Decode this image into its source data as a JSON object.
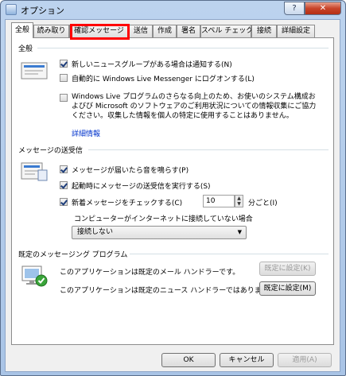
{
  "window": {
    "title": "オプション",
    "help_label": "?",
    "close_label": "✕"
  },
  "tabs": [
    {
      "label": "全般"
    },
    {
      "label": "読み取り"
    },
    {
      "label": "確認メッセージ"
    },
    {
      "label": "送信"
    },
    {
      "label": "作成"
    },
    {
      "label": "署名"
    },
    {
      "label": "スペル チェック"
    },
    {
      "label": "接続"
    },
    {
      "label": "詳細設定"
    }
  ],
  "general": {
    "title": "全般",
    "notify_newsgroups": {
      "label": "新しいニュースグループがある場合は通知する(N)",
      "checked": true
    },
    "auto_login_messenger": {
      "label": "自動的に Windows Live Messenger にログオンする(L)",
      "checked": false
    },
    "improvement_program": {
      "label": "Windows Live プログラムのさらなる向上のため、お使いのシステム構成およびび Microsoft のソフトウェアのご利用状況についての情報収集にご協力ください。収集した情報を個人の特定に使用することはありません。",
      "checked": false
    },
    "details_link": "詳細情報"
  },
  "send_receive": {
    "title": "メッセージの送受信",
    "play_sound": {
      "label": "メッセージが届いたら音を鳴らす(P)",
      "checked": true
    },
    "send_receive_startup": {
      "label": "起動時にメッセージの送受信を実行する(S)",
      "checked": true
    },
    "check_new": {
      "label": "新着メッセージをチェックする(C)",
      "checked": true
    },
    "interval_value": "10",
    "interval_unit": "分ごと(I)",
    "offline_label": "コンピューターがインターネットに接続していない場合",
    "offline_option": "接続しない"
  },
  "default_program": {
    "title": "既定のメッセージング プログラム",
    "mail_text": "このアプリケーションは既定のメール ハンドラーです。",
    "mail_button": "既定に設定(K)",
    "news_text": "このアプリケーションは既定のニュース ハンドラーではありません。",
    "news_button": "既定に設定(M)"
  },
  "footer": {
    "ok": "OK",
    "cancel": "キャンセル",
    "apply": "適用(A)"
  },
  "colors": {
    "highlight": "#ff0000",
    "link": "#0033cc"
  }
}
